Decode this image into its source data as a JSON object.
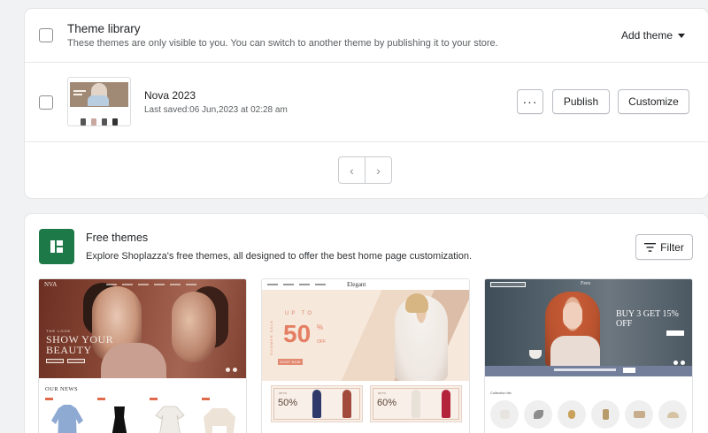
{
  "theme_library": {
    "title": "Theme library",
    "subtitle": "These themes are only visible to you. You can switch to another theme by publishing it to your store.",
    "add_theme_label": "Add theme",
    "themes": [
      {
        "name": "Nova 2023",
        "last_saved": "Last saved:06 Jun,2023 at 02:28 am",
        "more_label": "···",
        "publish_label": "Publish",
        "customize_label": "Customize"
      }
    ],
    "pager": {
      "prev_label": "‹",
      "next_label": "›"
    }
  },
  "free_themes": {
    "title": "Free themes",
    "subtitle": "Explore Shoplazza's free themes, all designed to offer the best home page customization.",
    "filter_label": "Filter",
    "cards": [
      {
        "brand": "NVA",
        "small_text": "THE LOOK",
        "headline_1": "SHOW YOUR",
        "headline_2": "BEAUTY",
        "section": "OUR NEWS"
      },
      {
        "brand": "Elegant",
        "upto": "UP TO",
        "side_text": "SUMMER SALE",
        "discount": "50",
        "percent": "%",
        "off": "OFF",
        "shop_now": "SHOP NOW",
        "promo_upto": "UP TO",
        "promos": [
          {
            "value": "50%"
          },
          {
            "value": "60%"
          }
        ]
      },
      {
        "brand": "Fern",
        "headline": "BUY 3 GET 15% OFF",
        "section": "Collection list"
      }
    ]
  },
  "colors": {
    "brand_green": "#1d7a48",
    "sale_orange": "#e47f64"
  }
}
